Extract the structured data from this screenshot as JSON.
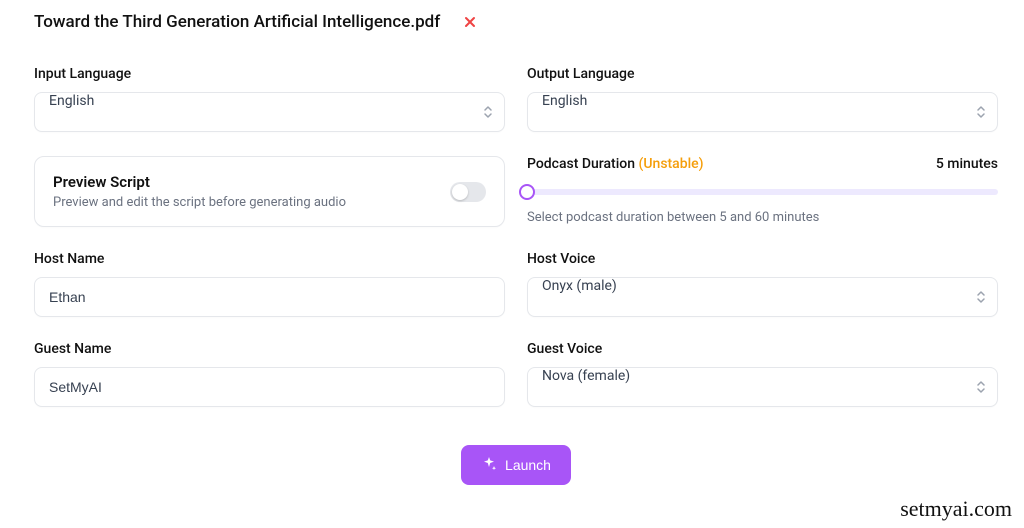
{
  "file": {
    "name": "Toward the Third Generation Artificial Intelligence.pdf"
  },
  "input_language": {
    "label": "Input Language",
    "value": "English"
  },
  "output_language": {
    "label": "Output Language",
    "value": "English"
  },
  "preview": {
    "title": "Preview Script",
    "description": "Preview and edit the script before generating audio",
    "enabled": false
  },
  "duration": {
    "label": "Podcast Duration",
    "tag": "(Unstable)",
    "value": "5 minutes",
    "help": "Select podcast duration between 5 and 60 minutes"
  },
  "host_name": {
    "label": "Host Name",
    "value": "Ethan"
  },
  "host_voice": {
    "label": "Host Voice",
    "value": "Onyx (male)"
  },
  "guest_name": {
    "label": "Guest Name",
    "value": "SetMyAI"
  },
  "guest_voice": {
    "label": "Guest Voice",
    "value": "Nova (female)"
  },
  "launch": {
    "label": "Launch"
  },
  "watermark": "setmyai.com"
}
